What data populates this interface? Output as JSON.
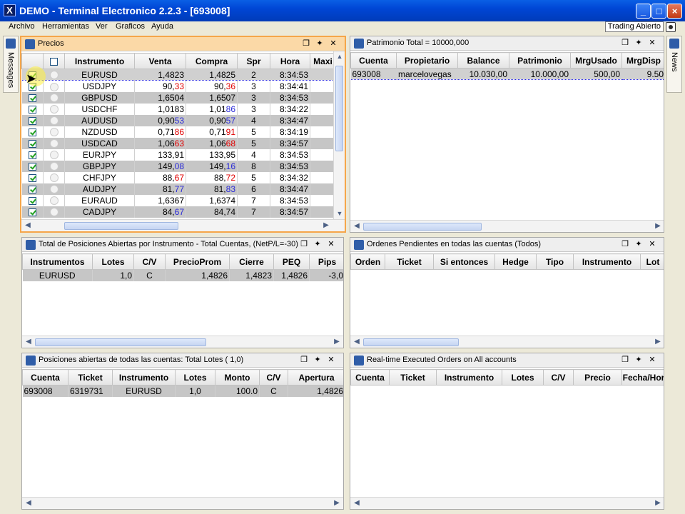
{
  "window": {
    "title": "DEMO - Terminal Electronico 2.2.3 - [693008]",
    "app_icon": "X",
    "minimize": "_",
    "maximize": "□",
    "close": "×"
  },
  "menu": [
    "Archivo",
    "Herramientas",
    "Ver",
    "Graficos",
    "Ayuda"
  ],
  "trading_status": "Trading Abierto",
  "sidetabs": {
    "left": "Messages",
    "right": "News"
  },
  "precios": {
    "title": "Precios",
    "columns": [
      "Instrumento",
      "Venta",
      "Compra",
      "Spr",
      "Hora",
      "Maxi"
    ],
    "rows": [
      {
        "inst": "EURUSD",
        "sell_a": "1,482",
        "sell_b": "3",
        "buy_a": "1,482",
        "buy_b": "5",
        "spr": "2",
        "time": "8:34:53",
        "sell_c": "",
        "buy_c": ""
      },
      {
        "inst": "USDJPY",
        "sell_a": "90,",
        "sell_b": "33",
        "buy_a": "90,",
        "buy_b": "36",
        "spr": "3",
        "time": "8:34:41",
        "sell_c": "red",
        "buy_c": "red"
      },
      {
        "inst": "GBPUSD",
        "sell_a": "1,650",
        "sell_b": "4",
        "buy_a": "1,650",
        "buy_b": "7",
        "spr": "3",
        "time": "8:34:53",
        "sell_c": "",
        "buy_c": ""
      },
      {
        "inst": "USDCHF",
        "sell_a": "1,018",
        "sell_b": "3",
        "buy_a": "1,01",
        "buy_b": "86",
        "spr": "3",
        "time": "8:34:22",
        "sell_c": "",
        "buy_c": "blue"
      },
      {
        "inst": "AUDUSD",
        "sell_a": "0,90",
        "sell_b": "53",
        "buy_a": "0,90",
        "buy_b": "57",
        "spr": "4",
        "time": "8:34:47",
        "sell_c": "blue",
        "buy_c": "blue"
      },
      {
        "inst": "NZDUSD",
        "sell_a": "0,71",
        "sell_b": "86",
        "buy_a": "0,71",
        "buy_b": "91",
        "spr": "5",
        "time": "8:34:19",
        "sell_c": "red",
        "buy_c": "red"
      },
      {
        "inst": "USDCAD",
        "sell_a": "1,06",
        "sell_b": "63",
        "buy_a": "1,06",
        "buy_b": "68",
        "spr": "5",
        "time": "8:34:57",
        "sell_c": "red",
        "buy_c": "red"
      },
      {
        "inst": "EURJPY",
        "sell_a": "133,9",
        "sell_b": "1",
        "buy_a": "133,9",
        "buy_b": "5",
        "spr": "4",
        "time": "8:34:53",
        "sell_c": "",
        "buy_c": ""
      },
      {
        "inst": "GBPJPY",
        "sell_a": "149,",
        "sell_b": "08",
        "buy_a": "149,",
        "buy_b": "16",
        "spr": "8",
        "time": "8:34:53",
        "sell_c": "blue",
        "buy_c": "blue"
      },
      {
        "inst": "CHFJPY",
        "sell_a": "88,",
        "sell_b": "67",
        "buy_a": "88,",
        "buy_b": "72",
        "spr": "5",
        "time": "8:34:32",
        "sell_c": "red",
        "buy_c": "red"
      },
      {
        "inst": "AUDJPY",
        "sell_a": "81,",
        "sell_b": "77",
        "buy_a": "81,",
        "buy_b": "83",
        "spr": "6",
        "time": "8:34:47",
        "sell_c": "blue",
        "buy_c": "blue"
      },
      {
        "inst": "EURAUD",
        "sell_a": "1,636",
        "sell_b": "7",
        "buy_a": "1,637",
        "buy_b": "4",
        "spr": "7",
        "time": "8:34:53",
        "sell_c": "",
        "buy_c": ""
      },
      {
        "inst": "CADJPY",
        "sell_a": "84,",
        "sell_b": "67",
        "buy_a": "84,74",
        "buy_b": "",
        "spr": "7",
        "time": "8:34:57",
        "sell_c": "blue",
        "buy_c": ""
      }
    ]
  },
  "patrimonio": {
    "title": "Patrimonio Total =  10000,000",
    "columns": [
      "Cuenta",
      "Propietario",
      "Balance",
      "Patrimonio",
      "MrgUsado",
      "MrgDisp"
    ],
    "row": [
      "693008",
      "marcelovegas",
      "10.030,00",
      "10.000,00",
      "500,00",
      "9.50"
    ]
  },
  "posiciones_instrumento": {
    "title": "Total de Posiciones Abiertas por Instrumento - Total Cuentas, (NetP/L=-30)",
    "columns": [
      "Instrumentos",
      "Lotes",
      "C/V",
      "PrecioProm",
      "Cierre",
      "PEQ",
      "Pips"
    ],
    "row": [
      "EURUSD",
      "1,0",
      "C",
      "1,4826",
      "1,4823",
      "1,4826",
      "-3,0"
    ]
  },
  "ordenes_pendientes": {
    "title": "Ordenes Pendientes en todas las cuentas (Todos)",
    "columns": [
      "Orden",
      "Ticket",
      "Si entonces",
      "Hedge",
      "Tipo",
      "Instrumento",
      "Lot"
    ]
  },
  "posiciones_abiertas": {
    "title": "Posiciones abiertas de todas las cuentas: Total Lotes ( 1,0)",
    "columns": [
      "Cuenta",
      "Ticket",
      "Instrumento",
      "Lotes",
      "Monto",
      "C/V",
      "Apertura"
    ],
    "row": [
      "693008",
      "6319731",
      "EURUSD",
      "1,0",
      "100.0",
      "C",
      "1,4826"
    ]
  },
  "executed_orders": {
    "title": "Real-time Executed Orders on All accounts",
    "columns": [
      "Cuenta",
      "Ticket",
      "Instrumento",
      "Lotes",
      "C/V",
      "Precio",
      "Fecha/Hor"
    ]
  },
  "icons": {
    "restore": "❐",
    "pin": "✦",
    "close": "✕"
  }
}
